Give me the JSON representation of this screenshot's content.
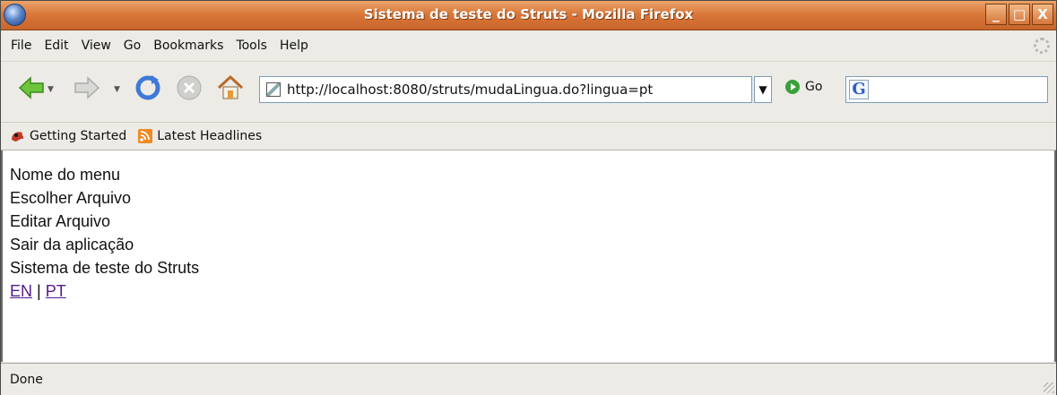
{
  "window": {
    "title": "Sistema de teste do Struts - Mozilla Firefox",
    "buttons": {
      "minimize": "_",
      "maximize": "□",
      "close": "X"
    }
  },
  "menubar": {
    "items": [
      "File",
      "Edit",
      "View",
      "Go",
      "Bookmarks",
      "Tools",
      "Help"
    ]
  },
  "navbar": {
    "url": "http://localhost:8080/struts/mudaLingua.do?lingua=pt",
    "go_label": "Go",
    "search_value": "",
    "icons": [
      "back-icon",
      "forward-icon",
      "reload-icon",
      "stop-icon",
      "home-icon"
    ]
  },
  "bookmarks": {
    "items": [
      {
        "label": "Getting Started",
        "icon": "getting-started-icon"
      },
      {
        "label": "Latest Headlines",
        "icon": "rss-icon"
      }
    ]
  },
  "content": {
    "lines": [
      "Nome do menu",
      "Escolher Arquivo",
      "Editar Arquivo",
      "Sair da aplicação",
      "Sistema de teste do Struts"
    ],
    "lang_links": [
      "EN",
      "PT"
    ],
    "separator": "|",
    "link_color": "#551a8b"
  },
  "status": {
    "text": "Done"
  },
  "colors": {
    "titlebar": "#d9783a",
    "chrome": "#ecebe6"
  }
}
